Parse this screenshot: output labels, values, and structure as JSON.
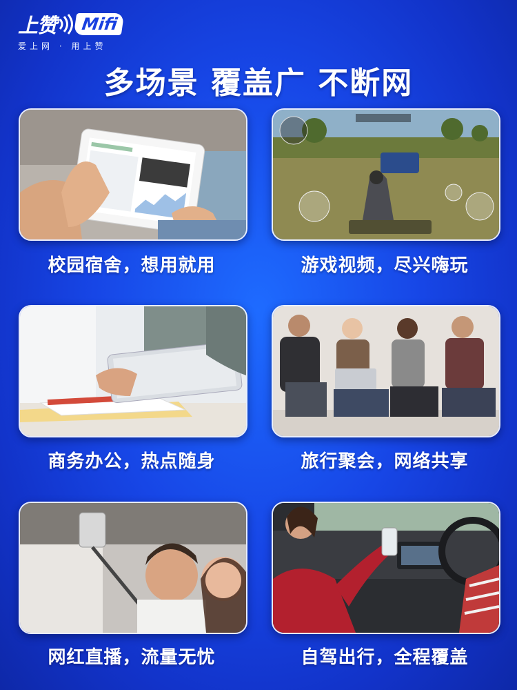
{
  "logo": {
    "brand_cn": "上赞",
    "brand_en": "Mifi",
    "slogan": "爱上网 · 用上赞"
  },
  "headline": "多场景 覆盖广 不断网",
  "scenes": [
    {
      "label": "校园宿舍，想用就用",
      "image": "person-holding-tablet-photo"
    },
    {
      "label": "游戏视频，尽兴嗨玩",
      "image": "mobile-game-screenshot"
    },
    {
      "label": "商务办公，热点随身",
      "image": "office-tablet-desk-photo"
    },
    {
      "label": "旅行聚会，网络共享",
      "image": "friends-group-laptop-photo"
    },
    {
      "label": "网红直播，流量无忧",
      "image": "couple-selfie-stick-photo"
    },
    {
      "label": "自驾出行，全程覆盖",
      "image": "car-driver-phone-photo"
    }
  ]
}
